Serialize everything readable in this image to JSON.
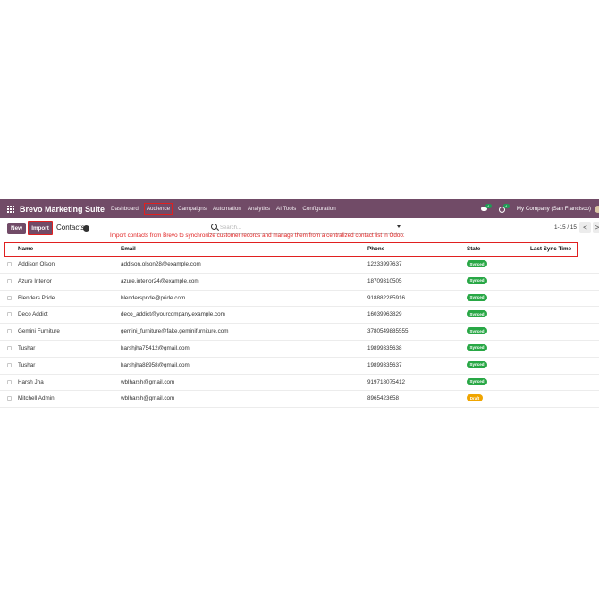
{
  "navbar": {
    "brand": "Brevo Marketing Suite",
    "items": [
      {
        "label": "Dashboard"
      },
      {
        "label": "Audience",
        "active": true
      },
      {
        "label": "Campaigns"
      },
      {
        "label": "Automation"
      },
      {
        "label": "Analytics"
      },
      {
        "label": "AI Tools"
      },
      {
        "label": "Configuration"
      }
    ],
    "chat_badge": "4",
    "activity_badge": "4",
    "company": "My Company (San Francisco)"
  },
  "control": {
    "new_label": "New",
    "import_label": "Import",
    "breadcrumb": "Contacts",
    "search_placeholder": "Search...",
    "pager": "1-15 / 15",
    "pager_prev": "<",
    "pager_next": ">"
  },
  "help_text": "Import contacts from Brevo to synchronize customer records and manage them from a centralized contact list in Odoo.",
  "table": {
    "headers": {
      "name": "Name",
      "email": "Email",
      "phone": "Phone",
      "state": "State",
      "last_sync": "Last Sync Time"
    },
    "rows": [
      {
        "name": "Addison Olson",
        "email": "addison.olson28@example.com",
        "phone": "12233997637",
        "state": "Synced"
      },
      {
        "name": "Azure Interior",
        "email": "azure.interior24@example.com",
        "phone": "18709310505",
        "state": "Synced"
      },
      {
        "name": "Blenders Pride",
        "email": "blenderspride@pride.com",
        "phone": "918882285916",
        "state": "Synced"
      },
      {
        "name": "Deco Addict",
        "email": "deco_addict@yourcompany.example.com",
        "phone": "16039963829",
        "state": "Synced"
      },
      {
        "name": "Gemini Furniture",
        "email": "gemini_furniture@fake.geminifurniture.com",
        "phone": "3780549885555",
        "state": "Synced"
      },
      {
        "name": "Tushar",
        "email": "harshjha75412@gmail.com",
        "phone": "19899335638",
        "state": "Synced"
      },
      {
        "name": "Tushar",
        "email": "harshjha88958@gmail.com",
        "phone": "19899335637",
        "state": "Synced"
      },
      {
        "name": "Harsh Jha",
        "email": "wblharsh@gmail.com",
        "phone": "919718075412",
        "state": "Synced"
      },
      {
        "name": "Mitchell Admin",
        "email": "wblharsh@gmail.com",
        "phone": "8965423658",
        "state": "Draft"
      }
    ]
  },
  "colors": {
    "brand": "#714b67",
    "synced": "#28a745",
    "draft": "#f0a500",
    "annotation": "#e02020"
  }
}
